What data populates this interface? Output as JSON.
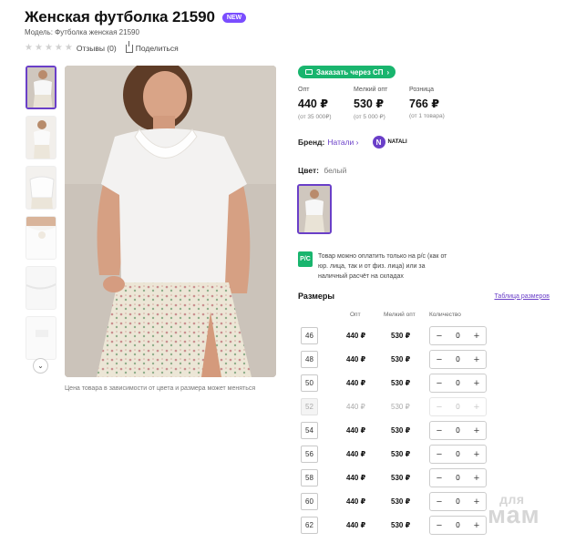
{
  "product": {
    "title": "Женская футболка 21590",
    "badge": "NEW",
    "model": "Модель: Футболка женская 21590",
    "reviews": "Отзывы (0)",
    "rating_stars": 0,
    "share": "Поделиться"
  },
  "gallery": {
    "note": "Цена товара в зависимости от цвета и размера может меняться"
  },
  "order_button": "Заказать через СП",
  "prices": [
    {
      "label": "Опт",
      "value": "440 ₽",
      "min": "(от 35 000₽)"
    },
    {
      "label": "Мелкий опт",
      "value": "530 ₽",
      "min": "(от 5 000 ₽)"
    },
    {
      "label": "Розница",
      "value": "766 ₽",
      "min": "(от 1 товара)"
    }
  ],
  "brand": {
    "label": "Бренд:",
    "name": "Натали",
    "logo_text": "NATALI",
    "logo_letter": "N"
  },
  "color": {
    "label": "Цвет:",
    "value": "белый"
  },
  "payment": {
    "icon_text": "P/C",
    "text": "Товар можно оплатить только на р/с (как от юр. лица, так и от физ. лица) или за наличный расчёт на складах"
  },
  "sizes": {
    "title": "Размеры",
    "table_link": "Таблица размеров",
    "columns": {
      "opt": "Опт",
      "small_opt": "Мелкий опт",
      "qty": "Количество"
    },
    "rows": [
      {
        "size": "46",
        "opt": "440 ₽",
        "small": "530 ₽",
        "qty": "0",
        "available": true
      },
      {
        "size": "48",
        "opt": "440 ₽",
        "small": "530 ₽",
        "qty": "0",
        "available": true
      },
      {
        "size": "50",
        "opt": "440 ₽",
        "small": "530 ₽",
        "qty": "0",
        "available": true
      },
      {
        "size": "52",
        "opt": "440 ₽",
        "small": "530 ₽",
        "qty": "0",
        "available": false
      },
      {
        "size": "54",
        "opt": "440 ₽",
        "small": "530 ₽",
        "qty": "0",
        "available": true
      },
      {
        "size": "56",
        "opt": "440 ₽",
        "small": "530 ₽",
        "qty": "0",
        "available": true
      },
      {
        "size": "58",
        "opt": "440 ₽",
        "small": "530 ₽",
        "qty": "0",
        "available": true
      },
      {
        "size": "60",
        "opt": "440 ₽",
        "small": "530 ₽",
        "qty": "0",
        "available": true
      },
      {
        "size": "62",
        "opt": "440 ₽",
        "small": "530 ₽",
        "qty": "0",
        "available": true
      }
    ],
    "minus": "−",
    "plus": "+"
  },
  "watermark": {
    "top": "для",
    "bottom": "мам"
  },
  "colors": {
    "accent": "#6a3fc8",
    "green": "#19b56e",
    "new_badge": "#7a4dff"
  }
}
